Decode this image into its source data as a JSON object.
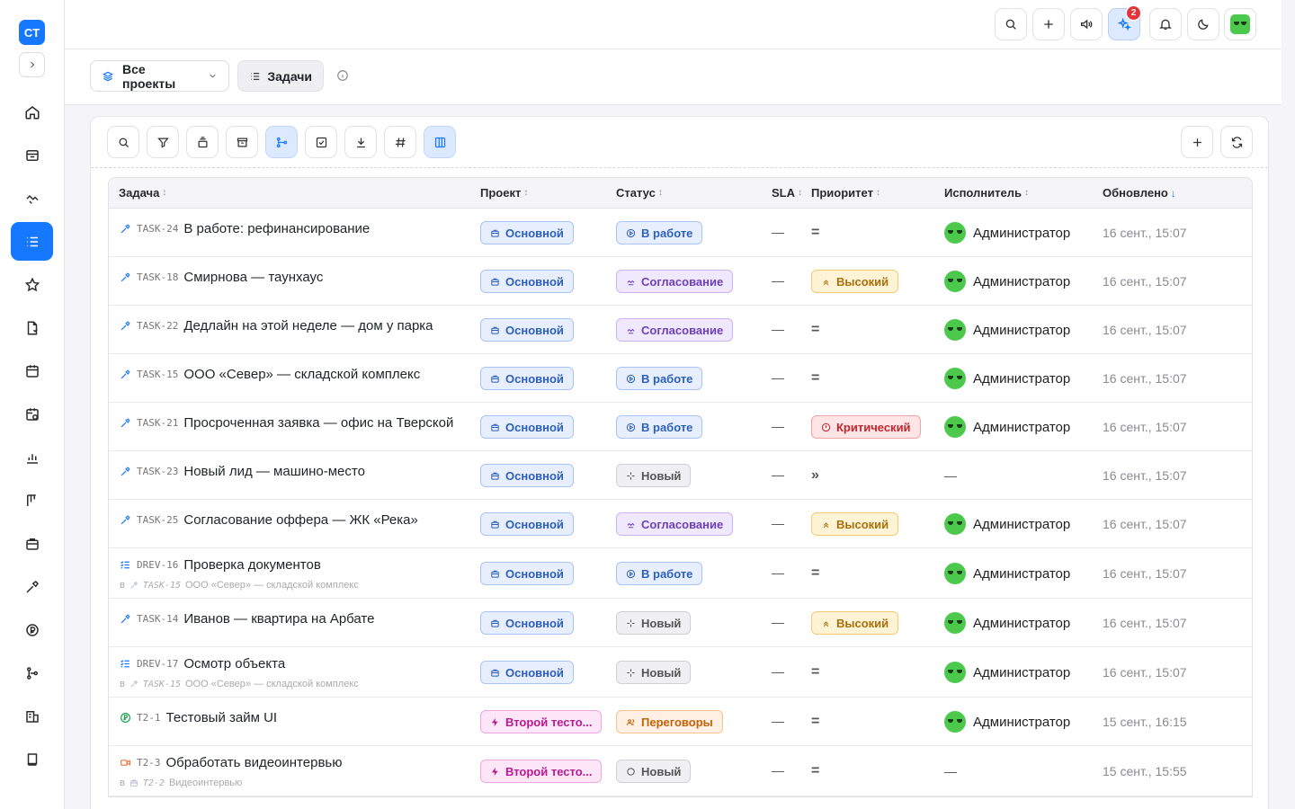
{
  "app": {
    "logo_text": "CT"
  },
  "sidebar": {
    "items": [
      {
        "name": "home"
      },
      {
        "name": "inbox"
      },
      {
        "name": "handshake"
      },
      {
        "name": "tasks",
        "active": true
      },
      {
        "name": "favorites"
      },
      {
        "name": "documents"
      },
      {
        "name": "calendar"
      },
      {
        "name": "schedule"
      },
      {
        "name": "analytics"
      },
      {
        "name": "kanban"
      },
      {
        "name": "briefcase"
      },
      {
        "name": "tools"
      },
      {
        "name": "finance"
      },
      {
        "name": "structure"
      },
      {
        "name": "buildings"
      },
      {
        "name": "book"
      }
    ]
  },
  "header": {
    "notifications_badge": "2"
  },
  "subheader": {
    "project_select": "Все проекты",
    "tab_tasks": "Задачи"
  },
  "table": {
    "columns": {
      "task": "Задача",
      "project": "Проект",
      "status": "Статус",
      "sla": "SLA",
      "priority": "Приоритет",
      "assignee": "Исполнитель",
      "updated": "Обновлено"
    },
    "rows": [
      {
        "key": "TASK-24",
        "title": "В работе: рефинансирование",
        "project": "Основной",
        "status": "В работе",
        "sla": "—",
        "priority": "=",
        "assignee": "Администратор",
        "updated": "16 сент., 15:07"
      },
      {
        "key": "TASK-18",
        "title": "Смирнова — таунхаус",
        "project": "Основной",
        "status": "Согласование",
        "sla": "—",
        "priority": "Высокий",
        "assignee": "Администратор",
        "updated": "16 сент., 15:07"
      },
      {
        "key": "TASK-22",
        "title": "Дедлайн на этой неделе — дом у парка",
        "project": "Основной",
        "status": "Согласование",
        "sla": "—",
        "priority": "=",
        "assignee": "Администратор",
        "updated": "16 сент., 15:07"
      },
      {
        "key": "TASK-15",
        "title": "ООО «Север» — складской комплекс",
        "project": "Основной",
        "status": "В работе",
        "sla": "—",
        "priority": "=",
        "assignee": "Администратор",
        "updated": "16 сент., 15:07"
      },
      {
        "key": "TASK-21",
        "title": "Просроченная заявка — офис на Тверской",
        "project": "Основной",
        "status": "В работе",
        "sla": "—",
        "priority": "Критический",
        "assignee": "Администратор",
        "updated": "16 сент., 15:07"
      },
      {
        "key": "TASK-23",
        "title": "Новый лид — машино-место",
        "project": "Основной",
        "status": "Новый",
        "sla": "—",
        "priority": "»",
        "assignee": "—",
        "updated": "16 сент., 15:07"
      },
      {
        "key": "TASK-25",
        "title": "Согласование оффера — ЖК «Река»",
        "project": "Основной",
        "status": "Согласование",
        "sla": "—",
        "priority": "Высокий",
        "assignee": "Администратор",
        "updated": "16 сент., 15:07"
      },
      {
        "key": "DREV-16",
        "title": "Проверка документов",
        "parent_prefix": "в",
        "parent_key": "TASK-15",
        "parent_title": "ООО «Север» — складской комплекс",
        "project": "Основной",
        "status": "В работе",
        "sla": "—",
        "priority": "=",
        "assignee": "Администратор",
        "updated": "16 сент., 15:07"
      },
      {
        "key": "TASK-14",
        "title": "Иванов — квартира на Арбате",
        "project": "Основной",
        "status": "Новый",
        "sla": "—",
        "priority": "Высокий",
        "assignee": "Администратор",
        "updated": "16 сент., 15:07"
      },
      {
        "key": "DREV-17",
        "title": "Осмотр объекта",
        "parent_prefix": "в",
        "parent_key": "TASK-15",
        "parent_title": "ООО «Север» — складской комплекс",
        "project": "Основной",
        "status": "Новый",
        "sla": "—",
        "priority": "=",
        "assignee": "Администратор",
        "updated": "16 сент., 15:07"
      },
      {
        "key": "T2-1",
        "title": "Тестовый займ UI",
        "project": "Второй тесто...",
        "status": "Переговоры",
        "sla": "—",
        "priority": "=",
        "assignee": "Администратор",
        "updated": "15 сент., 16:15"
      },
      {
        "key": "T2-3",
        "title": "Обработать видеоинтервью",
        "parent_prefix": "в",
        "parent_key": "T2-2",
        "parent_title": "Видеоинтервью",
        "project": "Второй тесто...",
        "status": "Новый",
        "sla": "—",
        "priority": "=",
        "assignee": "—",
        "updated": "15 сент., 15:55"
      }
    ]
  }
}
